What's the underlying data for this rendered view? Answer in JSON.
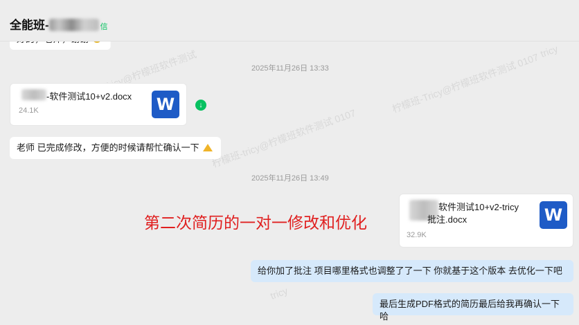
{
  "header": {
    "title_prefix": "全能班-",
    "title_suffix": "信"
  },
  "watermarks": [
    "柠檬班-Tricy@柠檬班软件测试 0107",
    "tricy",
    "柠檬班-tricy@柠檬班软件测试 0107",
    "柠檬班-Tricy@柠檬班软件测试",
    "tricy"
  ],
  "messages": {
    "top_partial": "好的，老师，谢谢",
    "timestamp_1": "2025年11月26日 13:33",
    "file_1": {
      "name": "-软件测试10+v2.docx",
      "size": "24.1K",
      "icon": "W"
    },
    "reply_1": "老师 已完成修改，方便的时候请帮忙确认一下",
    "timestamp_2": "2025年11月26日 13:49",
    "file_2": {
      "name_line1": "软件测试10+v2-tricy",
      "name_line2": "批注.docx",
      "size": "32.9K",
      "icon": "W"
    },
    "reply_2": "给你加了批注  项目哪里格式也调整了了一下  你就基于这个版本 去优化一下吧",
    "reply_3": "最后生成PDF格式的简历最后给我再确认一下哈"
  },
  "annotation": "第二次简历的一对一修改和优化",
  "colors": {
    "accent_green": "#07c160",
    "word_blue": "#1e5bc6",
    "annotation_red": "#e02020",
    "self_bubble": "#d6e9fb"
  }
}
